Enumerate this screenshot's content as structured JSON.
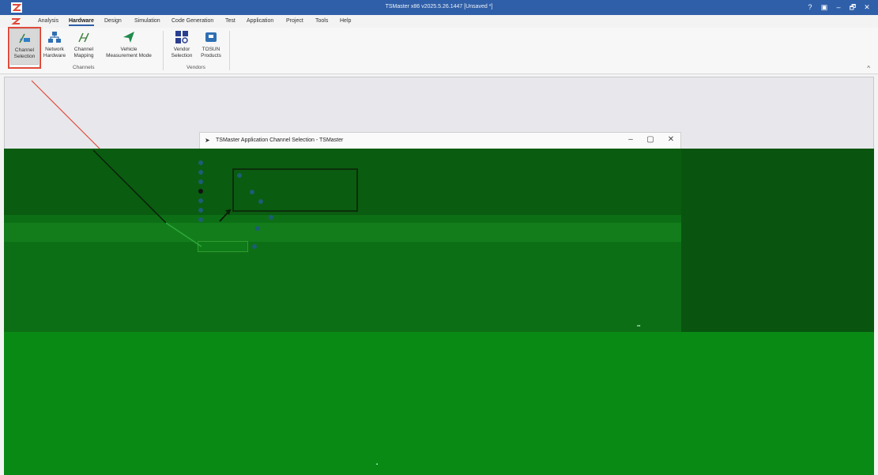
{
  "window": {
    "title": "TSMaster x86 v2025.5.26.1447 [Unsaved *]",
    "controls": [
      "?",
      "▣",
      "–",
      "🗗",
      "✕"
    ]
  },
  "menu": {
    "items": [
      "Analysis",
      "Hardware",
      "Design",
      "Simulation",
      "Code Generation",
      "Test",
      "Application",
      "Project",
      "Tools",
      "Help"
    ],
    "active": "Hardware"
  },
  "ribbon": {
    "channels_group": {
      "label": "Channels",
      "buttons": [
        {
          "line1": "Channel",
          "line2": "Selection",
          "icon": "channel-selection-icon"
        },
        {
          "line1": "Network",
          "line2": "Hardware",
          "icon": "network-hardware-icon"
        },
        {
          "line1": "Channel",
          "line2": "Mapping",
          "icon": "channel-mapping-icon"
        },
        {
          "line1": "Vehicle",
          "line2": "Measurement Mode",
          "icon": "vehicle-measurement-icon"
        }
      ]
    },
    "vendors_group": {
      "label": "Vendors",
      "buttons": [
        {
          "line1": "Vendor",
          "line2": "Selection",
          "icon": "vendor-selection-icon"
        },
        {
          "line1": "TOSUN",
          "line2": "Products",
          "icon": "tosun-products-icon"
        }
      ]
    },
    "collapse": "^"
  },
  "dialog": {
    "title": "TSMaster Application Channel Selection - TSMaster",
    "icon": "cursor-icon",
    "controls": [
      "–",
      "▢",
      "✕"
    ]
  },
  "colors": {
    "titlebar": "#2f5fa8",
    "highlight": "#e04a3b",
    "overlay_green": "#0a5c10"
  }
}
